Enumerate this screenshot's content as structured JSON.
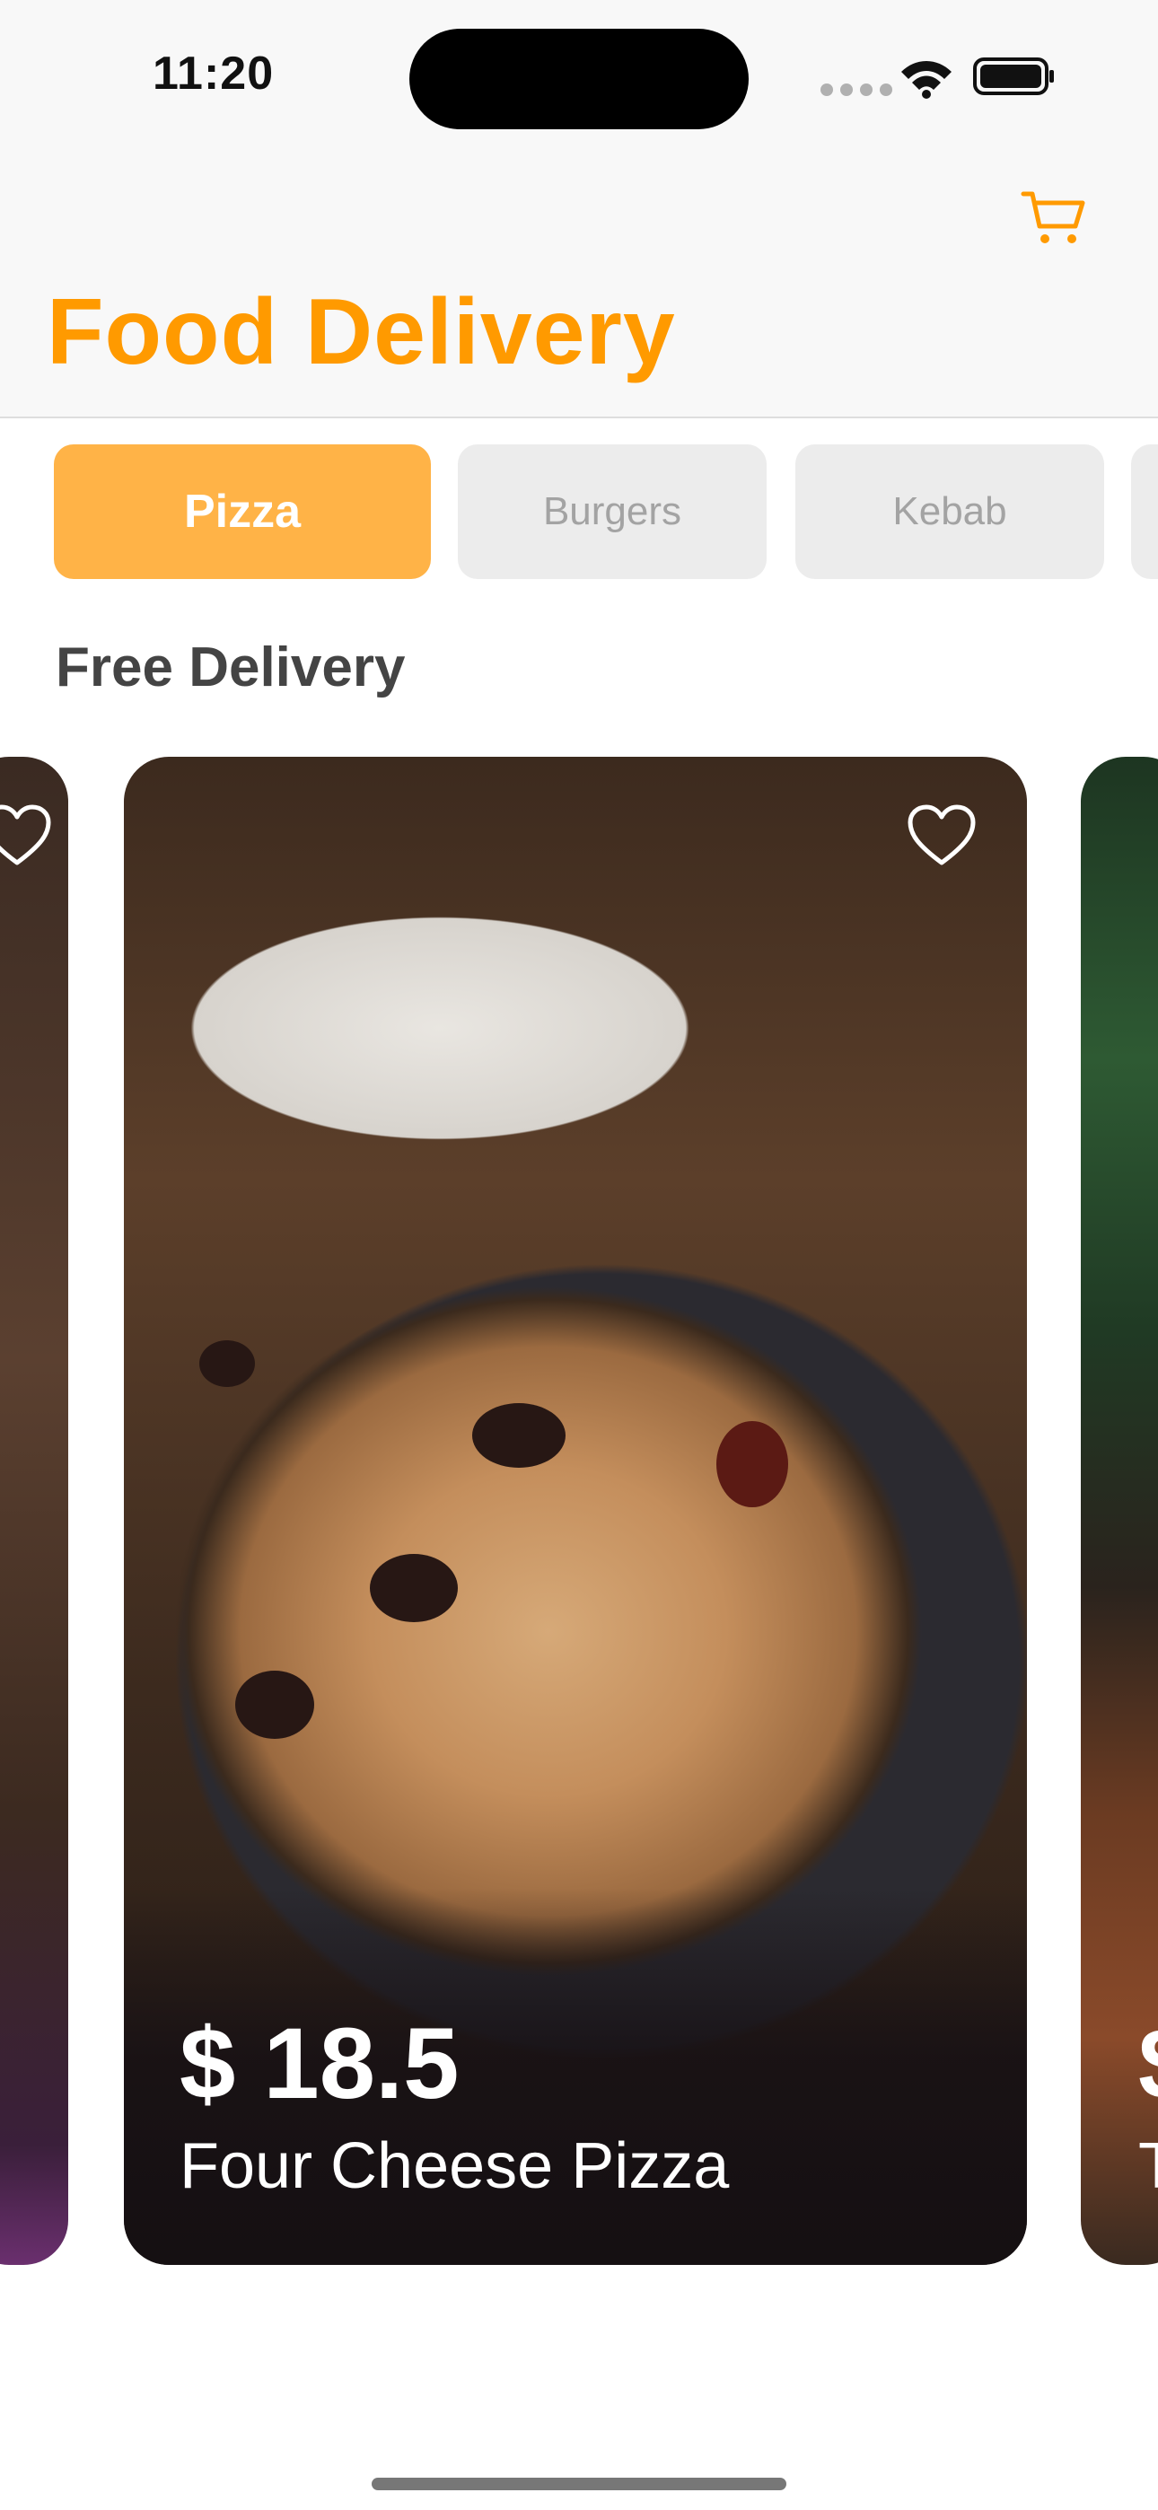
{
  "status_bar": {
    "time": "11:20"
  },
  "header": {
    "title": "Food Delivery",
    "accent_color": "#ff9a00",
    "cart_icon": "cart-icon"
  },
  "categories": [
    {
      "label": "Pizza",
      "selected": true
    },
    {
      "label": "Burgers",
      "selected": false
    },
    {
      "label": "Kebab",
      "selected": false
    }
  ],
  "section": {
    "title": "Free Delivery"
  },
  "cards": {
    "main": {
      "price": "$ 18.5",
      "name": "Four Cheese Pizza",
      "favorite_icon": "heart-icon"
    },
    "right_peek": {
      "price": "$",
      "name": "T"
    }
  }
}
